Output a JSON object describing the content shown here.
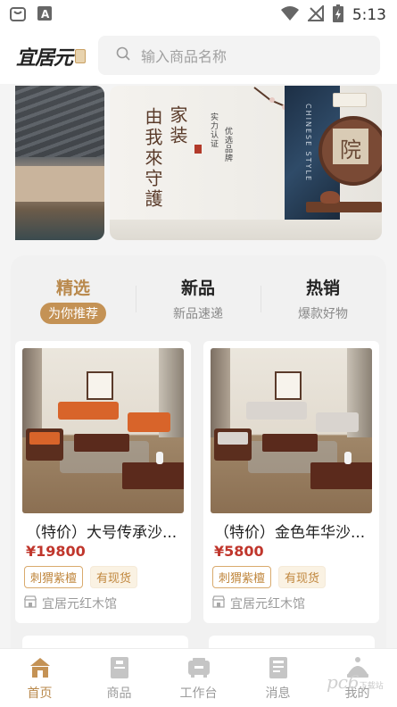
{
  "status_bar": {
    "time": "5:13",
    "icons": [
      "bag-icon",
      "text-a-icon",
      "wifi-icon",
      "no-signal-icon",
      "battery-charging-icon"
    ]
  },
  "header": {
    "logo_text": "宜居元",
    "search_placeholder": "输入商品名称"
  },
  "banner": {
    "title_col1": "家装",
    "title_col2": "由我來守護",
    "slogan_col1": "实力认证",
    "slogan_col2": "优选品牌",
    "panel_text": "CHINESE STYLE",
    "seal_char": "院"
  },
  "tabs": [
    {
      "title": "精选",
      "sub": "为你推荐",
      "active": true
    },
    {
      "title": "新品",
      "sub": "新品速递",
      "active": false
    },
    {
      "title": "热销",
      "sub": "爆款好物",
      "active": false
    }
  ],
  "products": [
    {
      "title": "（特价）大号传承沙...",
      "price": "¥19800",
      "tags": [
        "刺猬紫檀",
        "有现货"
      ],
      "shop": "宜居元红木馆",
      "sofa_color": "#d8642a"
    },
    {
      "title": "（特价）金色年华沙...",
      "price": "¥5800",
      "tags": [
        "刺猬紫檀",
        "有现货"
      ],
      "shop": "宜居元红木馆",
      "sofa_color": "#d9d4cf"
    }
  ],
  "tabbar": [
    {
      "label": "首页",
      "icon": "home-icon",
      "active": true
    },
    {
      "label": "商品",
      "icon": "goods-icon",
      "active": false
    },
    {
      "label": "工作台",
      "icon": "workbench-icon",
      "active": false
    },
    {
      "label": "消息",
      "icon": "message-icon",
      "active": false
    },
    {
      "label": "我的",
      "icon": "profile-icon",
      "active": false
    }
  ],
  "watermark": {
    "text": "pc6",
    "sub": "下载站"
  },
  "colors": {
    "accent": "#b9894c",
    "price": "#c0362c",
    "pill": "#c49255"
  }
}
